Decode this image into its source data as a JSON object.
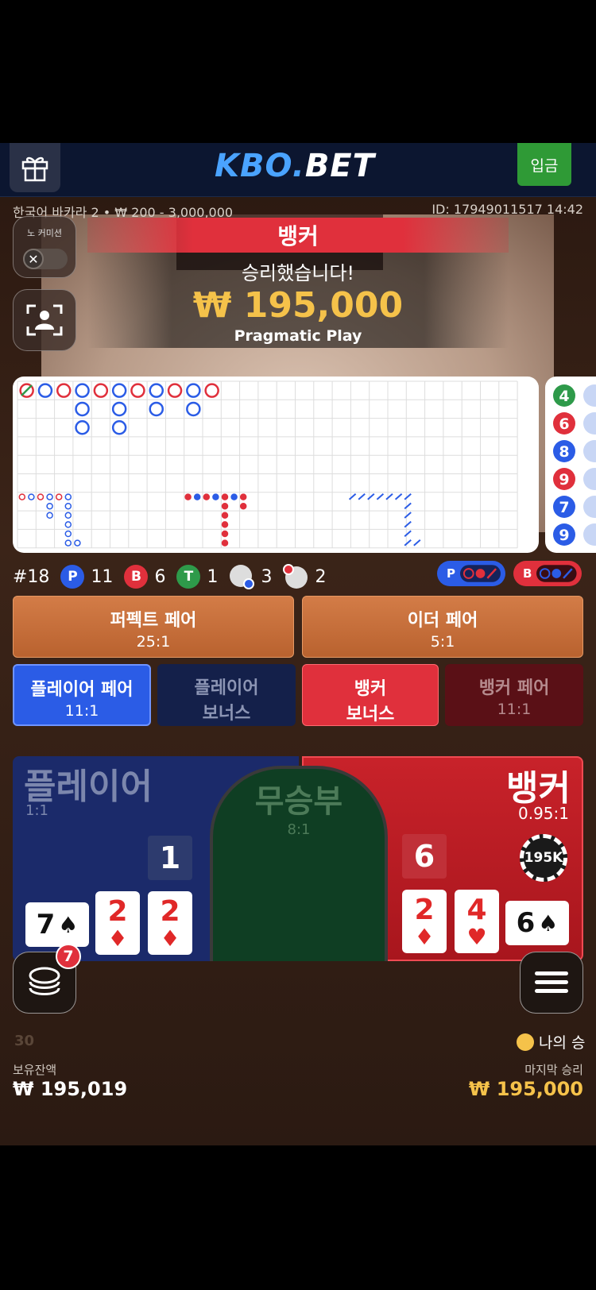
{
  "header": {
    "logo_kbo": "KBO",
    "logo_dot": ".",
    "logo_bet": "BET",
    "deposit_label": "입금"
  },
  "info": {
    "table": "한국어 바카라 2 • ₩ 200 - 3,000,000",
    "id": "ID: 17949011517 14:42"
  },
  "no_commission": {
    "label": "노 커미션",
    "toggle": "✕"
  },
  "win": {
    "winner": "뱅커",
    "message": "승리했습니다!",
    "amount": "₩ 195,000",
    "provider": "Pragmatic Play"
  },
  "stats": {
    "round": "#18",
    "player_letter": "P",
    "player_count": "11",
    "banker_letter": "B",
    "banker_count": "6",
    "tie_letter": "T",
    "tie_count": "1",
    "ppair_count": "3",
    "bpair_count": "2",
    "pred_p": "P",
    "pred_b": "B"
  },
  "bets": {
    "perfect_pair": {
      "name": "퍼펙트 페어",
      "odds": "25:1"
    },
    "either_pair": {
      "name": "이더 페어",
      "odds": "5:1"
    },
    "player_pair": {
      "name": "플레이어 페어",
      "odds": "11:1"
    },
    "player_bonus": {
      "name1": "플레이어",
      "name2": "보너스"
    },
    "banker_bonus": {
      "name1": "뱅커",
      "name2": "보너스"
    },
    "banker_pair": {
      "name": "뱅커 페어",
      "odds": "11:1"
    },
    "player": {
      "name": "플레이어",
      "odds": "1:1",
      "score": "1"
    },
    "tie": {
      "name": "무승부",
      "odds": "8:1"
    },
    "banker": {
      "name": "뱅커",
      "odds": "0.95:1",
      "score": "6",
      "chip": "195K"
    }
  },
  "player_cards": [
    {
      "rank": "7",
      "suit": "♠",
      "color": "#111111"
    },
    {
      "rank": "2",
      "suit": "♦",
      "color": "#e02828"
    },
    {
      "rank": "2",
      "suit": "♦",
      "color": "#e02828"
    }
  ],
  "banker_cards": [
    {
      "rank": "2",
      "suit": "♦",
      "color": "#e02828"
    },
    {
      "rank": "4",
      "suit": "♥",
      "color": "#e02828"
    },
    {
      "rank": "6",
      "suit": "♠",
      "color": "#111111"
    }
  ],
  "side_road": [
    "4",
    "6",
    "8",
    "9",
    "7",
    "9"
  ],
  "chat_badge": "7",
  "bottom": {
    "left_small": "30",
    "right_small": "나의 승",
    "balance_label": "보유잔액",
    "balance": "₩ 195,019",
    "last_win_label": "마지막 승리",
    "last_win": "₩ 195,000"
  },
  "colors": {
    "player": "#2b5ce6",
    "banker": "#e0303c",
    "tie": "#2e9a4a",
    "gold": "#f5c24a"
  }
}
